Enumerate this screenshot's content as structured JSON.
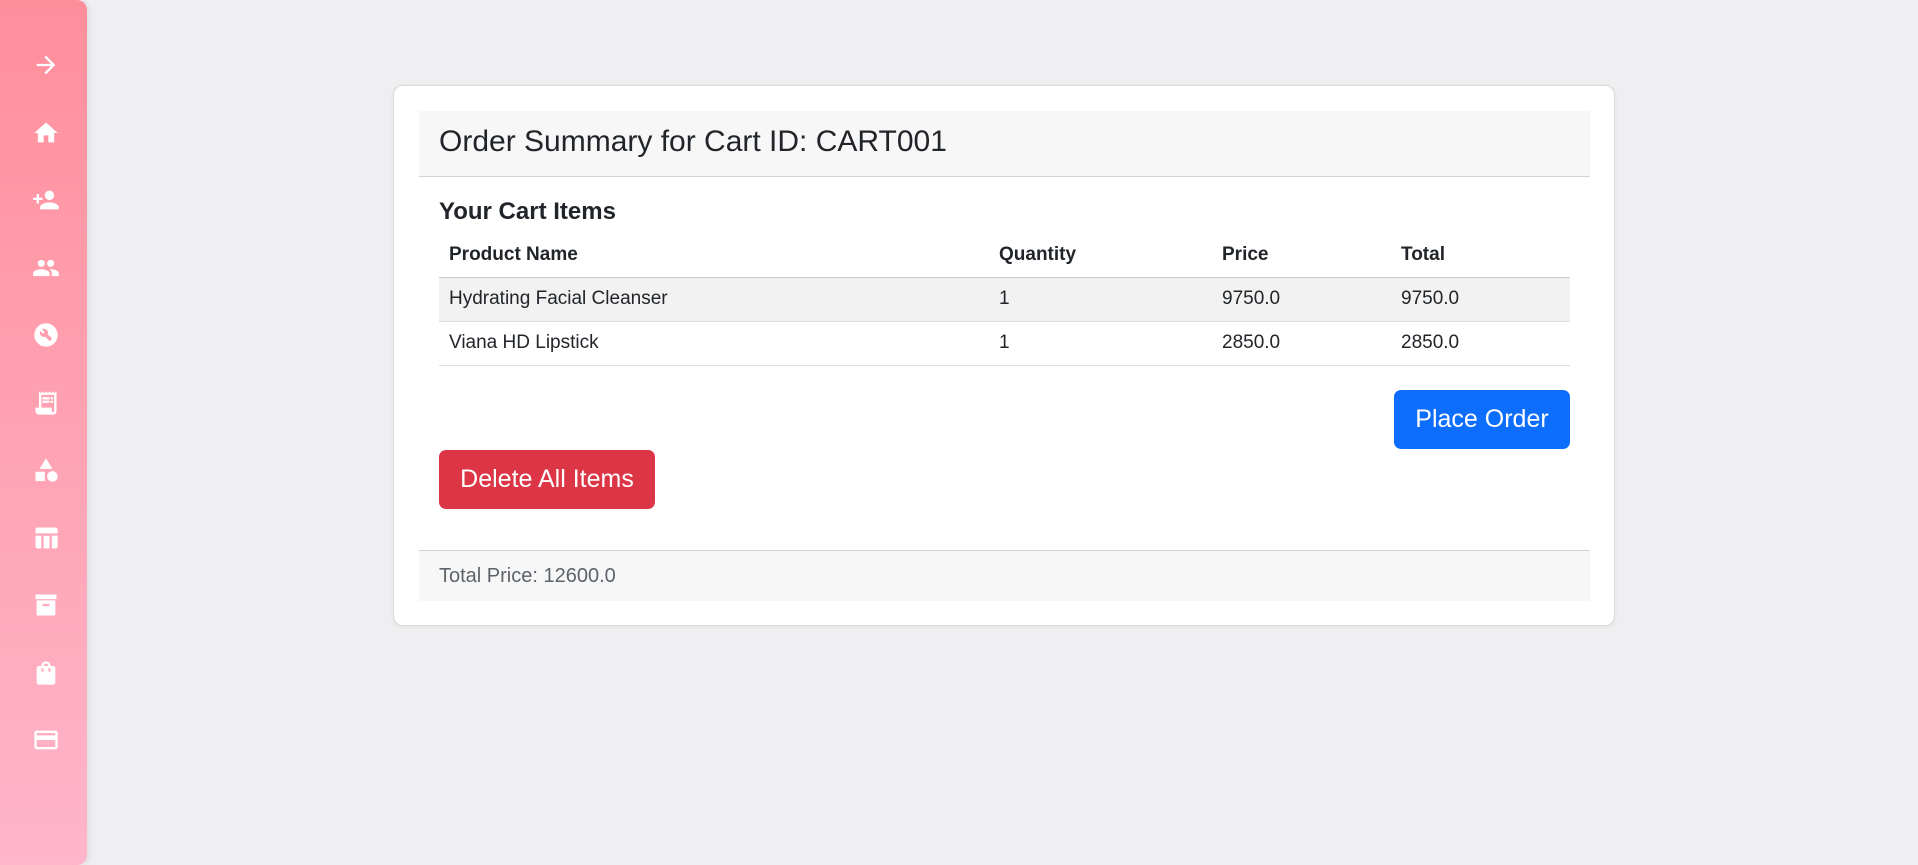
{
  "sidebar": {
    "items": [
      {
        "icon": "arrow-right-icon"
      },
      {
        "icon": "home-icon"
      },
      {
        "icon": "person-add-icon"
      },
      {
        "icon": "people-icon"
      },
      {
        "icon": "build-icon"
      },
      {
        "icon": "receipt-icon"
      },
      {
        "icon": "category-icon"
      },
      {
        "icon": "table-icon"
      },
      {
        "icon": "archive-icon"
      },
      {
        "icon": "shopping-bag-icon"
      },
      {
        "icon": "credit-card-icon"
      }
    ]
  },
  "card": {
    "title": "Order Summary for Cart ID: CART001",
    "section_title": "Your Cart Items"
  },
  "table": {
    "headers": [
      "Product Name",
      "Quantity",
      "Price",
      "Total"
    ],
    "rows": [
      [
        "Hydrating Facial Cleanser",
        "1",
        "9750.0",
        "9750.0"
      ],
      [
        "Viana HD Lipstick",
        "1",
        "2850.0",
        "2850.0"
      ]
    ]
  },
  "buttons": {
    "place_order": "Place Order",
    "delete_all": "Delete All Items"
  },
  "footer": {
    "total_price": "Total Price: 12600.0"
  },
  "colors": {
    "primary": "#0d6efd",
    "danger": "#dc3545",
    "sidebar_top": "#ff8e9b",
    "sidebar_bottom": "#ffb5cb"
  }
}
